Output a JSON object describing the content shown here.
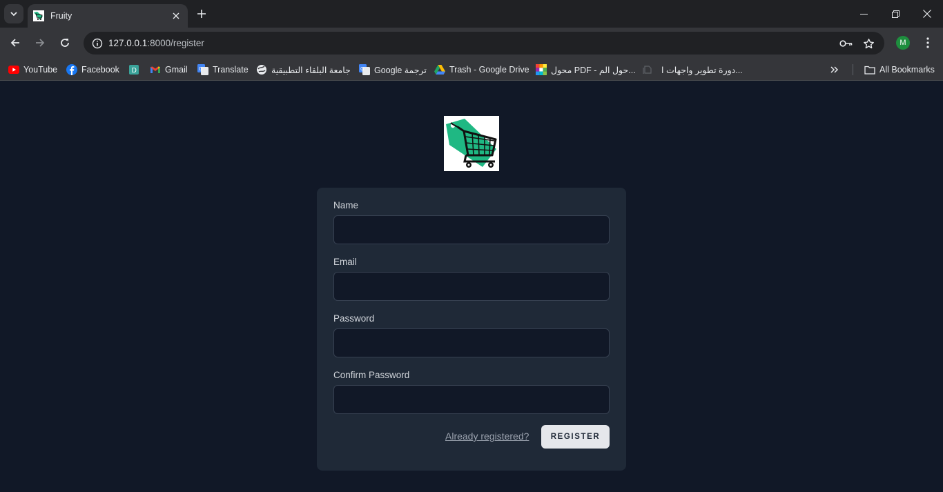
{
  "browser": {
    "tab": {
      "title": "Fruity"
    },
    "address": {
      "host": "127.0.0.1",
      "rest": ":8000/register"
    },
    "profile_initial": "M",
    "bookmarks": [
      {
        "label": "YouTube",
        "icon": "youtube-icon"
      },
      {
        "label": "Facebook",
        "icon": "facebook-icon"
      },
      {
        "label": "",
        "icon": "bookmark-d-icon"
      },
      {
        "label": "Gmail",
        "icon": "gmail-icon"
      },
      {
        "label": "Translate",
        "icon": "translate-icon"
      },
      {
        "label": "جامعة البلقاء التطبيقية",
        "icon": "globe-icon"
      },
      {
        "label": "Google ترجمة",
        "icon": "translate-icon"
      },
      {
        "label": "Trash - Google Drive",
        "icon": "drive-icon"
      },
      {
        "label": "محول PDF - حول الم...",
        "icon": "pdf-converter-icon"
      },
      {
        "label": "دورة تطوير واجهات ا...",
        "icon": "blank-page-icon"
      }
    ],
    "all_bookmarks": "All Bookmarks"
  },
  "form": {
    "name_label": "Name",
    "email_label": "Email",
    "password_label": "Password",
    "confirm_label": "Confirm Password",
    "name_value": "",
    "email_value": "",
    "password_value": "",
    "confirm_value": "",
    "login_link": "Already registered?",
    "submit": "REGISTER"
  },
  "colors": {
    "page_bg": "#111827",
    "card_bg": "#1f2937",
    "input_bg": "#111827",
    "button_bg": "#e5e7eb",
    "logo_green": "#1fb883"
  }
}
